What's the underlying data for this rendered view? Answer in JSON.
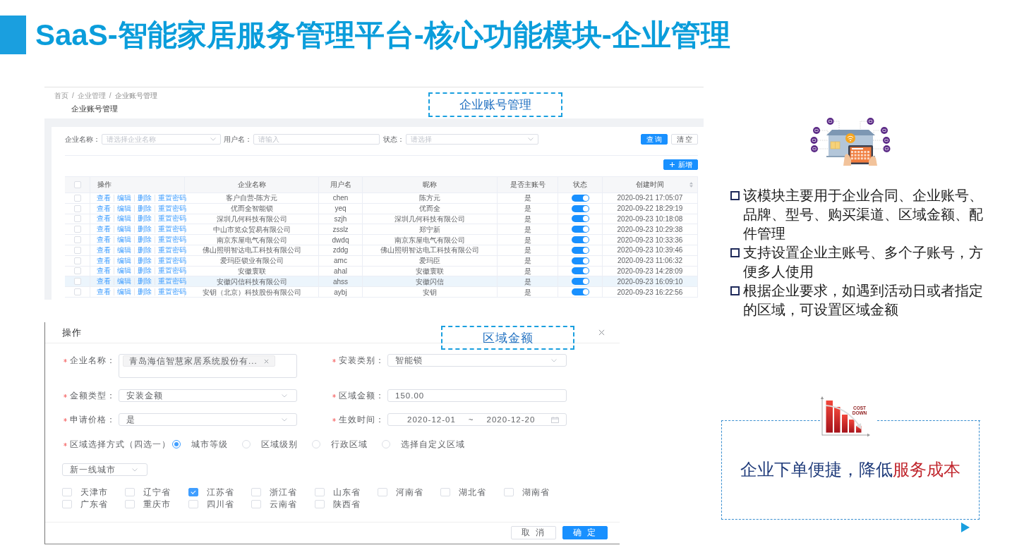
{
  "slide": {
    "title": "SaaS-智能家居服务管理平台-核心功能模块-企业管理"
  },
  "account_screenshot": {
    "callout": "企业账号管理",
    "breadcrumb": [
      {
        "kind": "link",
        "text": "首页"
      },
      {
        "kind": "separator",
        "text": "/"
      },
      {
        "kind": "link",
        "text": "企业管理"
      },
      {
        "kind": "separator",
        "text": "/"
      },
      {
        "kind": "current",
        "text": "企业账号管理"
      }
    ],
    "page_title": "企业账号管理",
    "filters": [
      {
        "label": "企业名称：",
        "kind": "select",
        "placeholder": "请选择企业名称"
      },
      {
        "label": "用户名：",
        "kind": "input",
        "placeholder": "请输入"
      },
      {
        "label": "状态：",
        "kind": "select",
        "placeholder": "请选择"
      }
    ],
    "filter_buttons": [
      {
        "label": "查 询",
        "kind": "primary"
      },
      {
        "label": "清 空",
        "kind": "default"
      }
    ],
    "add_button": {
      "label": "新增"
    },
    "table": {
      "all_checked": false,
      "columns": [
        {
          "label": "操作",
          "sortable": false
        },
        {
          "label": "企业名称",
          "sortable": false
        },
        {
          "label": "用户名",
          "sortable": false
        },
        {
          "label": "昵称",
          "sortable": false
        },
        {
          "label": "是否主账号",
          "sortable": false
        },
        {
          "label": "状态",
          "sortable": false
        },
        {
          "label": "创建时间",
          "sortable": true
        }
      ],
      "rows": [
        {
          "checked": false,
          "selected": false,
          "actions": [
            "查看",
            "编辑",
            "删除",
            "重置密码"
          ],
          "company": "客户自营-陈方元",
          "username": "chen",
          "nickname": "陈方元",
          "is_main": "是",
          "enabled": true,
          "created": "2020-09-21 17:05:07"
        },
        {
          "checked": false,
          "selected": false,
          "actions": [
            "查看",
            "编辑",
            "删除",
            "重置密码"
          ],
          "company": "优而全智能锁",
          "username": "yeq",
          "nickname": "优而全",
          "is_main": "是",
          "enabled": true,
          "created": "2020-09-22 18:29:19"
        },
        {
          "checked": false,
          "selected": false,
          "actions": [
            "查看",
            "编辑",
            "删除",
            "重置密码"
          ],
          "company": "深圳几何科技有限公司",
          "username": "szjh",
          "nickname": "深圳几何科技有限公司",
          "is_main": "是",
          "enabled": true,
          "created": "2020-09-23 10:18:08"
        },
        {
          "checked": false,
          "selected": false,
          "actions": [
            "查看",
            "编辑",
            "删除",
            "重置密码"
          ],
          "company": "中山市览众贸易有限公司",
          "username": "zsslz",
          "nickname": "郑宁新",
          "is_main": "是",
          "enabled": true,
          "created": "2020-09-23 10:29:38"
        },
        {
          "checked": false,
          "selected": false,
          "actions": [
            "查看",
            "编辑",
            "删除",
            "重置密码"
          ],
          "company": "南京东屋电气有限公司",
          "username": "dwdq",
          "nickname": "南京东屋电气有限公司",
          "is_main": "是",
          "enabled": true,
          "created": "2020-09-23 10:33:36"
        },
        {
          "checked": false,
          "selected": false,
          "actions": [
            "查看",
            "编辑",
            "删除",
            "重置密码"
          ],
          "company": "佛山照明智达电工科技有限公司",
          "username": "zddg",
          "nickname": "佛山照明智达电工科技有限公司",
          "is_main": "是",
          "enabled": true,
          "created": "2020-09-23 10:39:46"
        },
        {
          "checked": false,
          "selected": false,
          "actions": [
            "查看",
            "编辑",
            "删除",
            "重置密码"
          ],
          "company": "爱玛臣锁业有限公司",
          "username": "amc",
          "nickname": "爱玛臣",
          "is_main": "是",
          "enabled": true,
          "created": "2020-09-23 11:06:32"
        },
        {
          "checked": false,
          "selected": false,
          "actions": [
            "查看",
            "编辑",
            "删除",
            "重置密码"
          ],
          "company": "安徽寰联",
          "username": "ahal",
          "nickname": "安徽寰联",
          "is_main": "是",
          "enabled": true,
          "created": "2020-09-23 14:28:09"
        },
        {
          "checked": false,
          "selected": true,
          "actions": [
            "查看",
            "编辑",
            "删除",
            "重置密码"
          ],
          "company": "安徽闪信科技有限公司",
          "username": "ahss",
          "nickname": "安徽闪信",
          "is_main": "是",
          "enabled": true,
          "created": "2020-09-23 16:09:10"
        },
        {
          "checked": false,
          "selected": false,
          "actions": [
            "查看",
            "编辑",
            "删除",
            "重置密码"
          ],
          "company": "安钥（北京）科技股份有限公司",
          "username": "aybj",
          "nickname": "安钥",
          "is_main": "是",
          "enabled": true,
          "created": "2020-09-23 16:22:56"
        }
      ]
    }
  },
  "dialog": {
    "title": "操作",
    "callout": "区域金额",
    "fields": [
      {
        "label": "企业名称：",
        "required": true,
        "kind": "tags",
        "tags": [
          "青岛海信智慧家居系统股份有..."
        ]
      },
      {
        "label": "安装类别：",
        "required": true,
        "kind": "select",
        "value": "智能锁"
      },
      {
        "label": "金额类型：",
        "required": true,
        "kind": "select",
        "value": "安装金额"
      },
      {
        "label": "区域金额：",
        "required": true,
        "kind": "input",
        "value": "150.00"
      },
      {
        "label": "申请价格：",
        "required": true,
        "kind": "select",
        "value": "是"
      },
      {
        "label": "生效时间：",
        "required": true,
        "kind": "daterange",
        "start": "2020-12-01",
        "separator": "~",
        "end": "2020-12-20"
      }
    ],
    "region_mode": {
      "label": "区域选择方式（四选一）",
      "required": true,
      "options": [
        {
          "label": "城市等级",
          "selected": true
        },
        {
          "label": "区域级别",
          "selected": false
        },
        {
          "label": "行政区域",
          "selected": false
        },
        {
          "label": "选择自定义区域",
          "selected": false
        }
      ]
    },
    "city_level": {
      "value": "新一线城市"
    },
    "provinces": [
      {
        "label": "天津市",
        "checked": false
      },
      {
        "label": "辽宁省",
        "checked": false
      },
      {
        "label": "江苏省",
        "checked": true
      },
      {
        "label": "浙江省",
        "checked": false
      },
      {
        "label": "山东省",
        "checked": false
      },
      {
        "label": "河南省",
        "checked": false
      },
      {
        "label": "湖北省",
        "checked": false
      },
      {
        "label": "湖南省",
        "checked": false
      },
      {
        "label": "广东省",
        "checked": false
      },
      {
        "label": "重庆市",
        "checked": false
      },
      {
        "label": "四川省",
        "checked": false
      },
      {
        "label": "云南省",
        "checked": false
      },
      {
        "label": "陕西省",
        "checked": false
      }
    ],
    "buttons": [
      {
        "label": "取 消",
        "kind": "default"
      },
      {
        "label": "确 定",
        "kind": "primary"
      }
    ]
  },
  "description": {
    "bullets": [
      "该模块主要用于企业合同、企业账号、品牌、型号、购买渠道、区域金额、配件管理",
      "支持设置企业主账号、多个子账号，方便多人使用",
      "根据企业要求，如遇到活动日或者指定的区域，可设置区域金额"
    ]
  },
  "cost_illustration": {
    "label": "COST DOWN"
  },
  "summary": {
    "parts": [
      {
        "text": "企业下单便捷，降低",
        "emphasis": false
      },
      {
        "text": "服务成本",
        "emphasis": true
      }
    ]
  }
}
